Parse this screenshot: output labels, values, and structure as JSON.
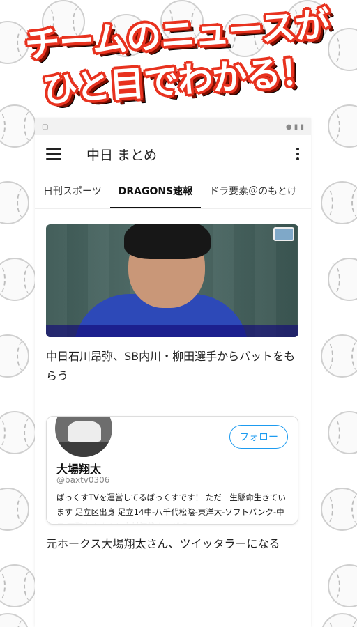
{
  "promo": {
    "line1": "チームのニュースが",
    "line2": "ひと目でわかる！"
  },
  "appbar": {
    "title": "中日 まとめ"
  },
  "tabs": [
    {
      "label": "日刊スポーツ",
      "active": false
    },
    {
      "label": "DRAGONS速報",
      "active": true
    },
    {
      "label": "ドラ要素＠のもとけ",
      "active": false
    }
  ],
  "articles": [
    {
      "title": "中日石川昂弥、SB内川・柳田選手からバットをもらう"
    },
    {
      "title": "元ホークス大場翔太さん、ツイッタラーになる"
    }
  ],
  "tweet": {
    "name": "大場翔太",
    "handle": "@baxtv0306",
    "follow_label": "フォロー",
    "bio": "ばっくすTVを運営してるばっくすです！ ただ一生懸命生きています 足立区出身 足立14中-八千代松陰-東洋大-ソフトバンク-中日 西野カナさんと木村拓哉さんが好"
  },
  "colors": {
    "promo_outline": "#e8321f",
    "follow_blue": "#1d9bf0"
  }
}
